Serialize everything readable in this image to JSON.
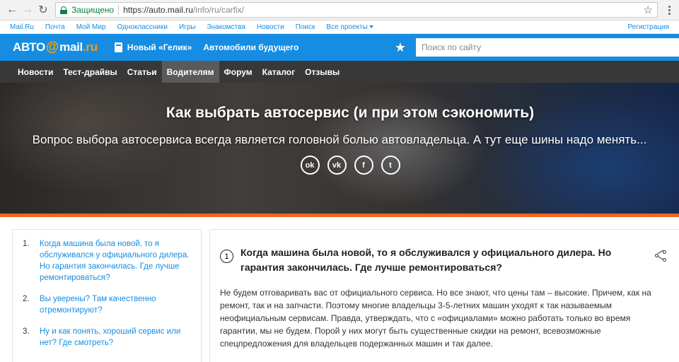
{
  "browser": {
    "secure_label": "Защищено",
    "url_host": "https://auto.mail.ru",
    "url_path": "/info/ru/carfix/"
  },
  "portal": {
    "links": [
      "Mail.Ru",
      "Почта",
      "Мой Мир",
      "Одноклассники",
      "Игры",
      "Знакомства",
      "Новости",
      "Поиск",
      "Все проекты"
    ],
    "register": "Регистрация"
  },
  "header": {
    "logo_left": "АВТО",
    "logo_at": "@",
    "logo_mail": "mail",
    "logo_ru": ".ru",
    "promo_1": "Новый «Гелик»",
    "promo_2": "Автомобили будущего",
    "search_placeholder": "Поиск по сайту"
  },
  "nav": {
    "items": [
      "Новости",
      "Тест-драйвы",
      "Статьи",
      "Водителям",
      "Форум",
      "Каталог",
      "Отзывы"
    ],
    "active_index": 3
  },
  "hero": {
    "title": "Как выбрать автосервис (и при этом сэкономить)",
    "subtitle": "Вопрос выбора автосервиса всегда является головной болью автовладельца. А тут еще шины надо менять...",
    "share": [
      {
        "icon": "odnoklassniki-icon",
        "glyph": "ok"
      },
      {
        "icon": "vk-icon",
        "glyph": "vk"
      },
      {
        "icon": "facebook-icon",
        "glyph": "f"
      },
      {
        "icon": "twitter-icon",
        "glyph": "t"
      }
    ]
  },
  "toc": {
    "items": [
      {
        "num": "1.",
        "text": "Когда машина была новой, то я обслуживался у официального дилера. Но гарантия закончилась. Где лучше ремонтироваться?"
      },
      {
        "num": "2.",
        "text": "Вы уверены? Там качественно отремонтируют?"
      },
      {
        "num": "3.",
        "text": "Ну и как понять, хороший сервис или нет? Где смотреть?"
      }
    ]
  },
  "article": {
    "number": "1",
    "title": "Когда машина была новой, то я обслуживался у официального дилера. Но гарантия закончилась. Где лучше ремонтироваться?",
    "text": "Не будем отговаривать вас от официального сервиса. Но все знают, что цены там – высокие. Причем, как на ремонт, так и на запчасти. Поэтому многие владельцы 3-5-летних машин уходят к так называемым неофициальным сервисам. Правда, утверждать, что с «официалами» можно работать только во время гарантии, мы не будем. Порой у них могут быть существенные скидки на ремонт, всевозможные спецпредложения для владельцев подержанных машин и так далее."
  },
  "colors": {
    "brand_blue": "#168de2",
    "accent_orange": "#f26522",
    "nav_dark": "#383838"
  }
}
